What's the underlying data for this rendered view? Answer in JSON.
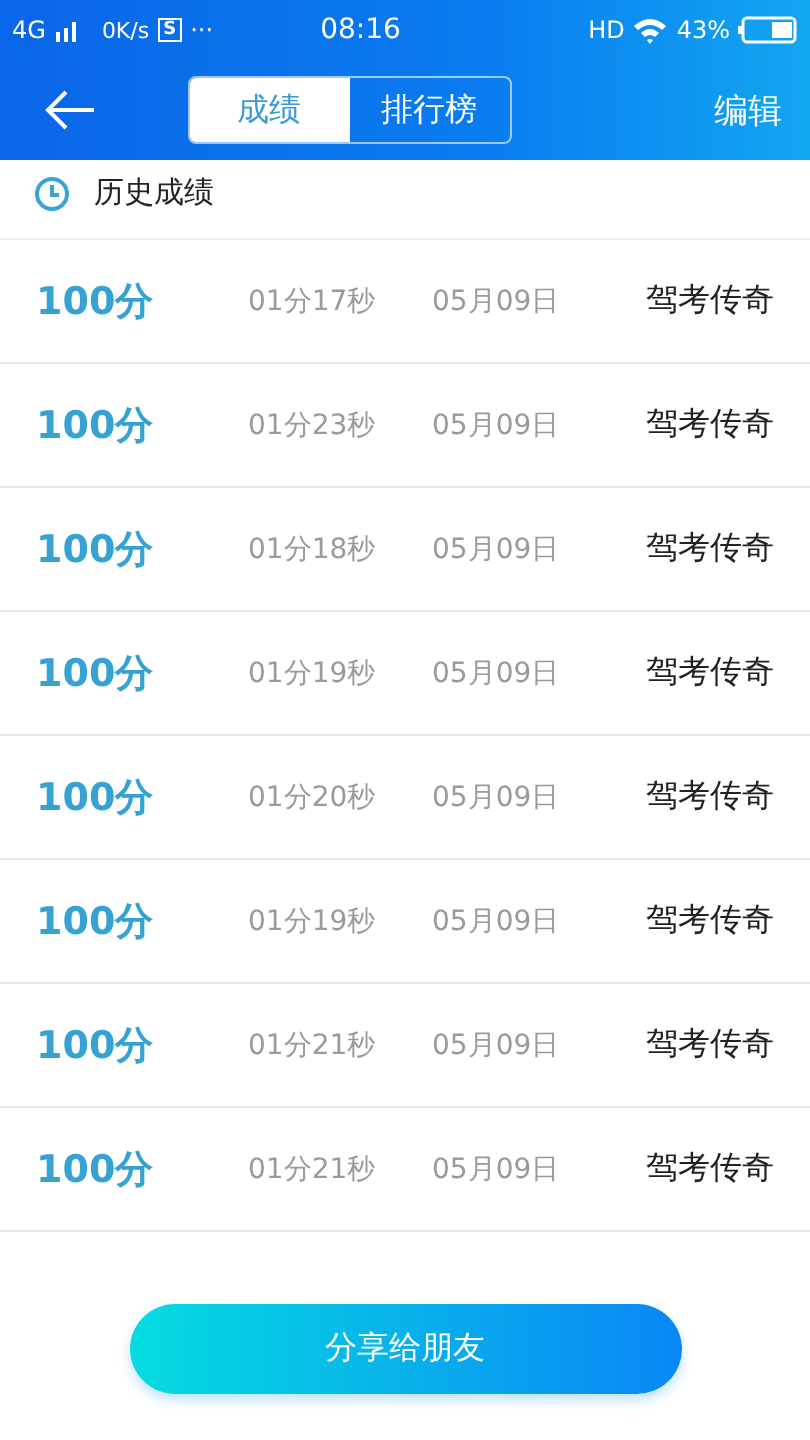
{
  "status_bar": {
    "network": "4G",
    "speed": "0K/s",
    "app_badge": "S",
    "more": "···",
    "time": "08:16",
    "hd": "HD",
    "battery": "43%"
  },
  "header": {
    "tabs": [
      {
        "label": "成绩",
        "selected": true
      },
      {
        "label": "排行榜",
        "selected": false
      }
    ],
    "edit": "编辑"
  },
  "section_title": "历史成绩",
  "rows": [
    {
      "score": "100分",
      "duration": "01分17秒",
      "date": "05月09日",
      "name": "驾考传奇"
    },
    {
      "score": "100分",
      "duration": "01分23秒",
      "date": "05月09日",
      "name": "驾考传奇"
    },
    {
      "score": "100分",
      "duration": "01分18秒",
      "date": "05月09日",
      "name": "驾考传奇"
    },
    {
      "score": "100分",
      "duration": "01分19秒",
      "date": "05月09日",
      "name": "驾考传奇"
    },
    {
      "score": "100分",
      "duration": "01分20秒",
      "date": "05月09日",
      "name": "驾考传奇"
    },
    {
      "score": "100分",
      "duration": "01分19秒",
      "date": "05月09日",
      "name": "驾考传奇"
    },
    {
      "score": "100分",
      "duration": "01分21秒",
      "date": "05月09日",
      "name": "驾考传奇"
    },
    {
      "score": "100分",
      "duration": "01分21秒",
      "date": "05月09日",
      "name": "驾考传奇"
    }
  ],
  "share_button": "分享给朋友"
}
